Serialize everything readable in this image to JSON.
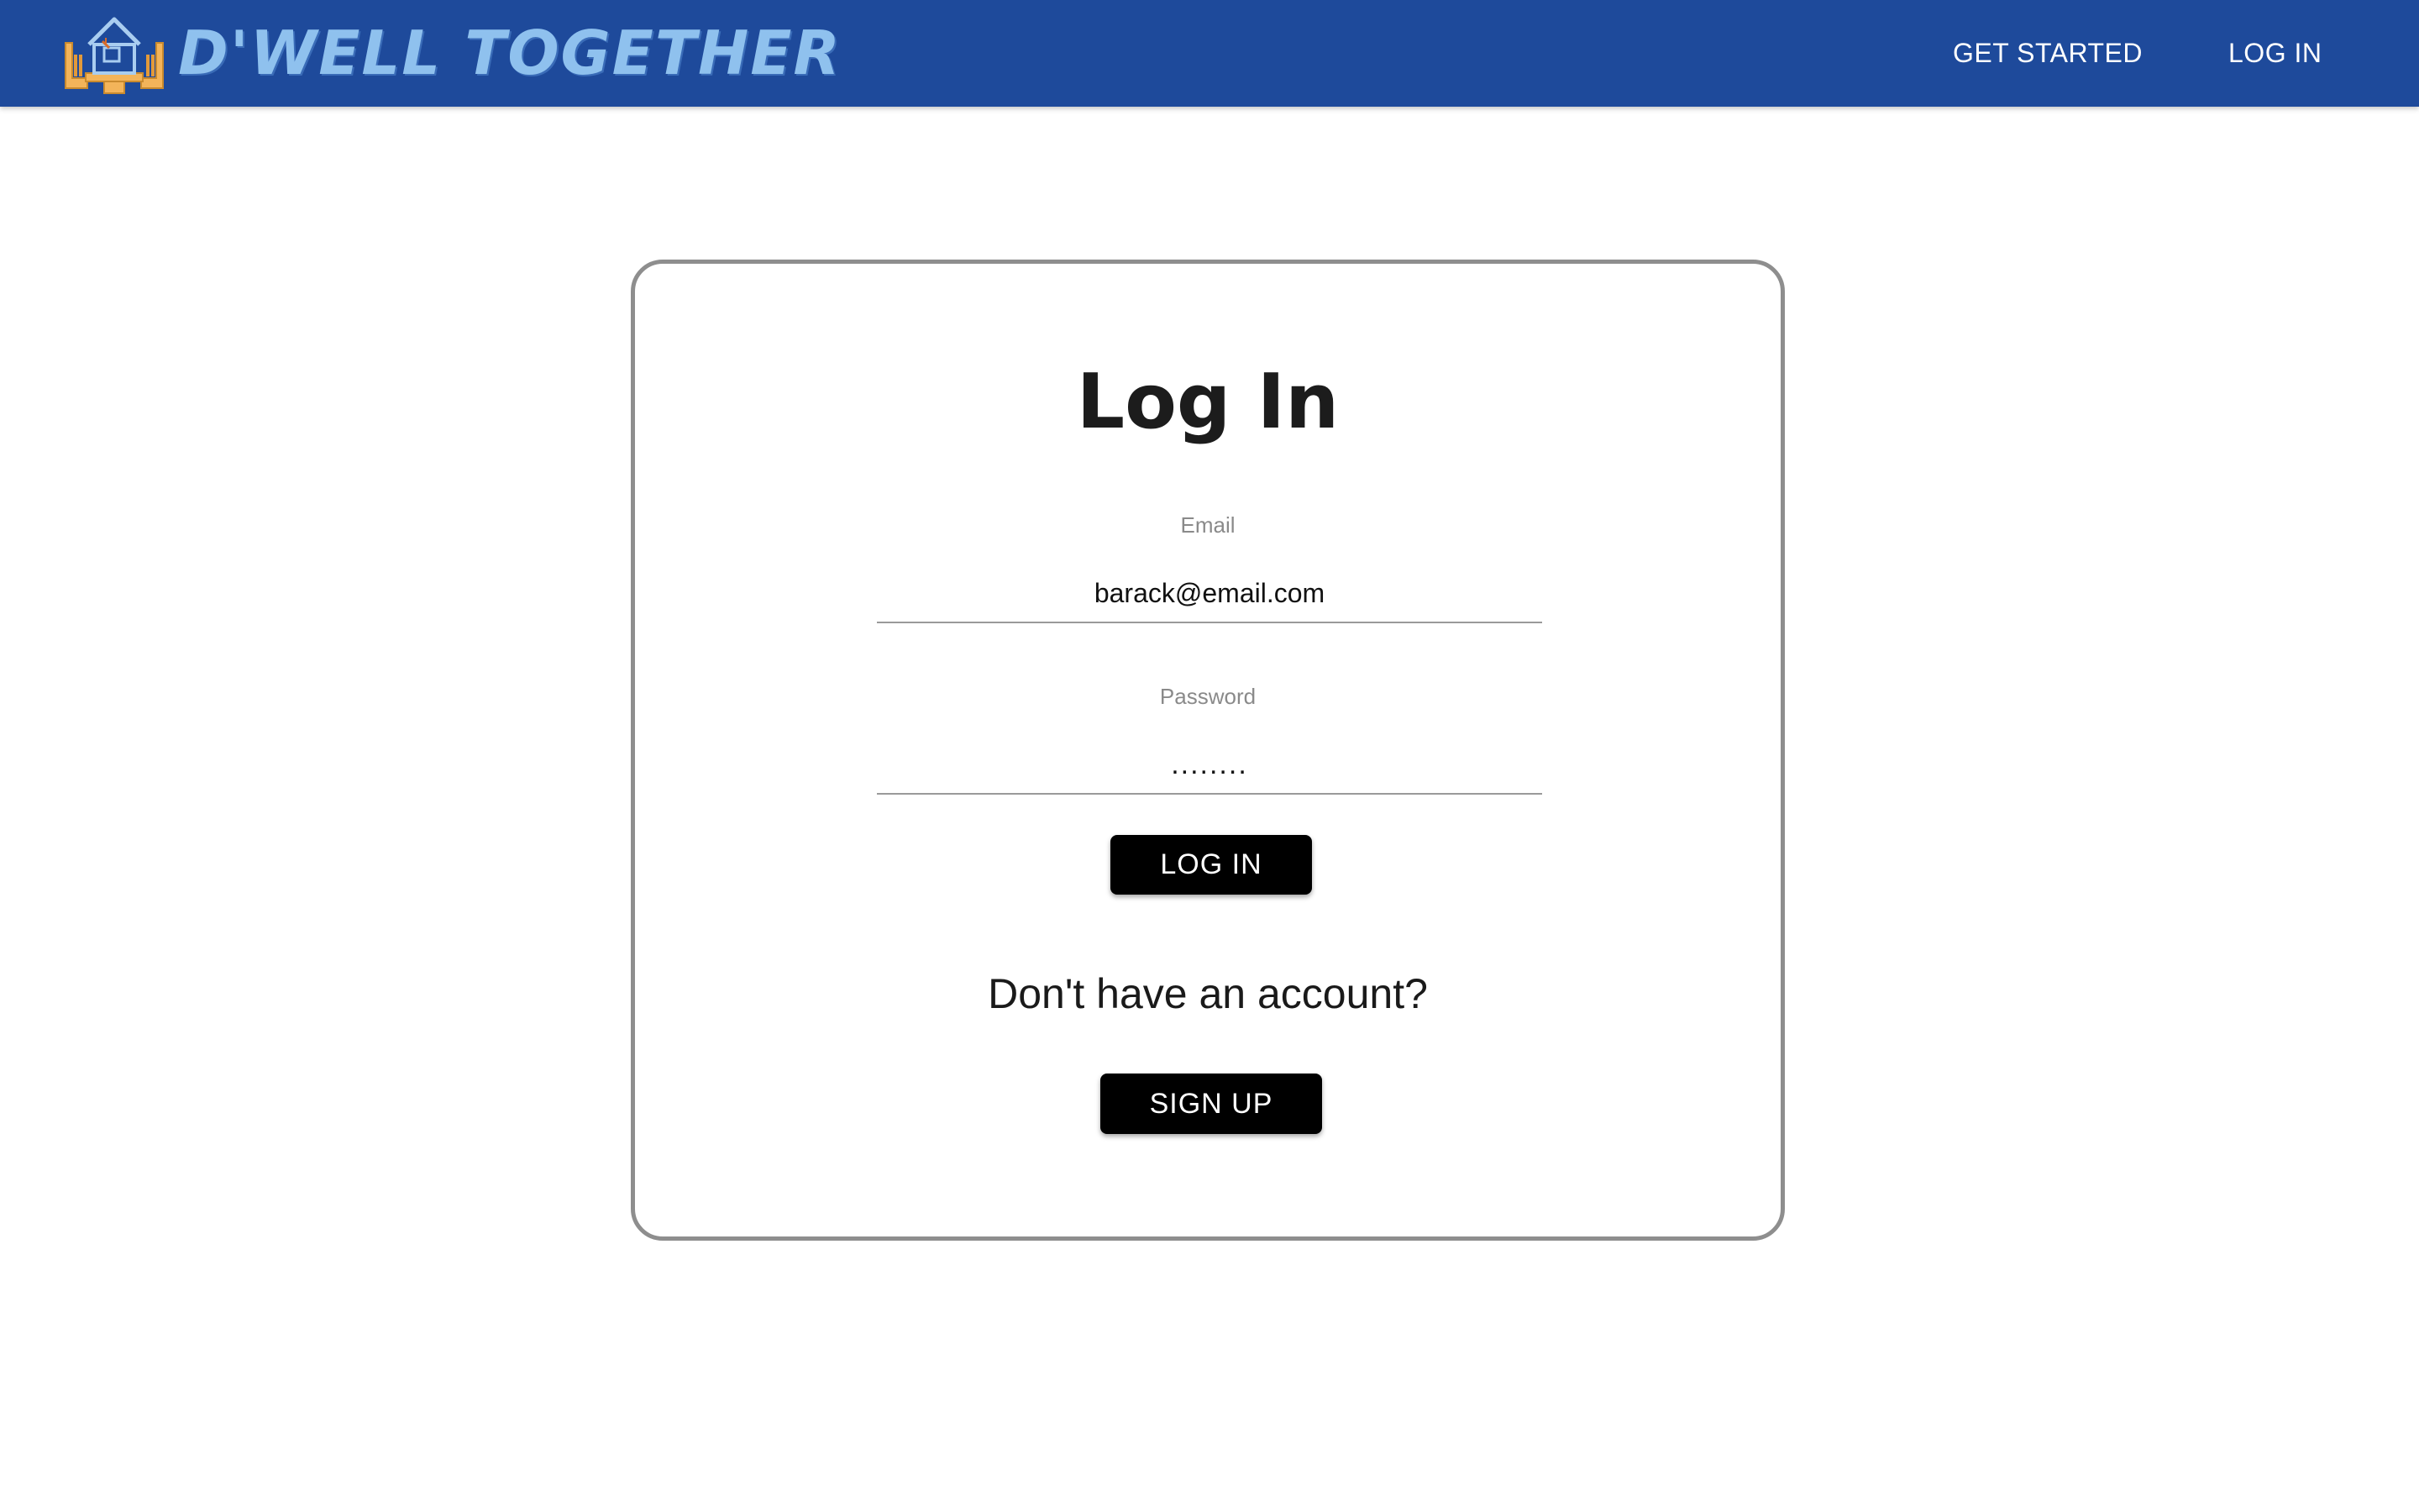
{
  "header": {
    "brand_name": "D'WELL TOGETHER",
    "logo_icon": "house-in-hands-icon",
    "background_color": "#1e4a9b",
    "brand_color": "#8fc1ee",
    "nav": {
      "get_started": "GET STARTED",
      "log_in": "LOG IN"
    }
  },
  "login_form": {
    "title": "Log In",
    "email": {
      "label": "Email",
      "value": "barack@email.com"
    },
    "password": {
      "label": "Password",
      "value": "........"
    },
    "submit_label": "LOG IN",
    "signup_prompt": "Don't have an account?",
    "signup_label": "SIGN UP"
  }
}
